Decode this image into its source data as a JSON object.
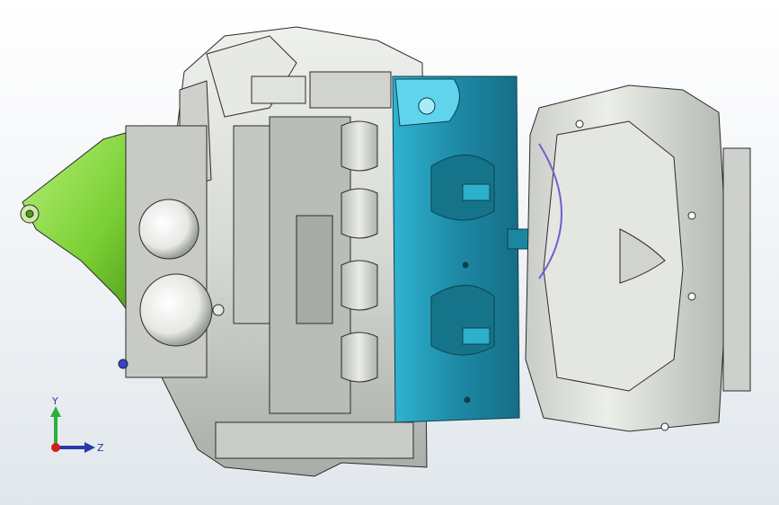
{
  "viewport": {
    "background_top": "#ffffff",
    "background_bottom": "#e1e7ec",
    "model": {
      "body_color": "#d9dcd8",
      "body_shadow": "#9ea29c",
      "cylinder_head_color": "#1e8aa6",
      "cylinder_head_highlight": "#36c2e0",
      "bracket_color": "#8fe04a",
      "bracket_shadow": "#4f9a1e",
      "outline_color": "#2b2b2b"
    }
  },
  "triad": {
    "y_label": "Y",
    "z_label": "Z",
    "y_color": "#2fae3c",
    "z_color": "#2a3aa8",
    "x_color": "#d02020"
  }
}
